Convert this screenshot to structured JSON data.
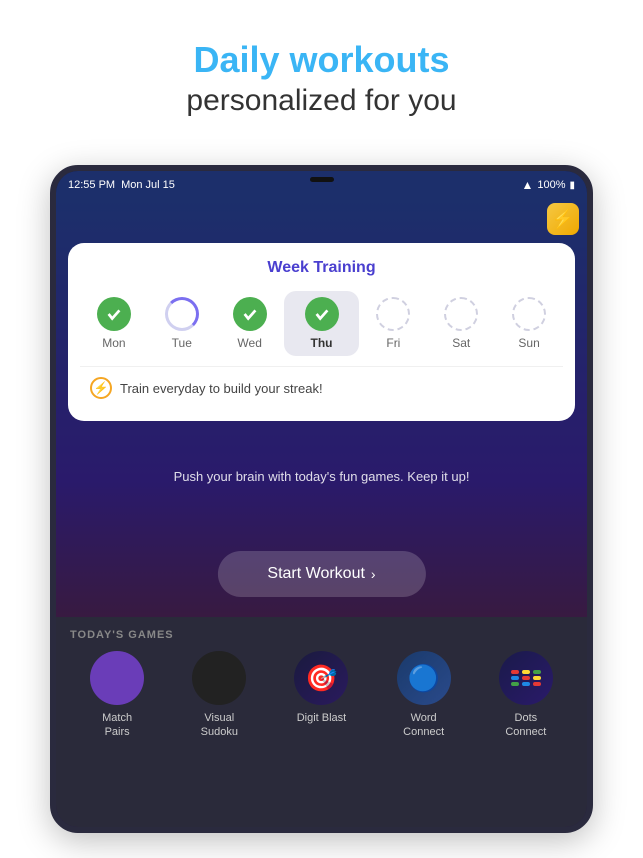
{
  "hero": {
    "title": "Daily workouts",
    "subtitle": "personalized for you"
  },
  "status_bar": {
    "time": "12:55 PM",
    "date": "Mon Jul 15",
    "wifi": "WiFi",
    "battery": "100%"
  },
  "week_training": {
    "title": "Week Training",
    "days": [
      {
        "label": "Mon",
        "state": "completed"
      },
      {
        "label": "Tue",
        "state": "partial"
      },
      {
        "label": "Wed",
        "state": "completed"
      },
      {
        "label": "Thu",
        "state": "active",
        "selected": true
      },
      {
        "label": "Fri",
        "state": "empty"
      },
      {
        "label": "Sat",
        "state": "empty"
      },
      {
        "label": "Sun",
        "state": "empty"
      }
    ],
    "streak_text": "Train everyday to build your streak!"
  },
  "push_text": "Push your brain with today's fun games. Keep it up!",
  "start_workout": {
    "label": "Start Workout",
    "chevron": "›"
  },
  "todays_games": {
    "section_label": "TODAY'S GAMES",
    "games": [
      {
        "name": "Match\nPairs",
        "icon_type": "match-pairs"
      },
      {
        "name": "Visual\nSudoku",
        "icon_type": "sudoku"
      },
      {
        "name": "Digit Blast",
        "icon_type": "digit-blast"
      },
      {
        "name": "Word\nConnect",
        "icon_type": "word-connect"
      },
      {
        "name": "Dots\nConnect",
        "icon_type": "dots-connect"
      }
    ]
  },
  "colors": {
    "accent_blue": "#3ab5f5",
    "text_dark": "#333333",
    "card_title": "#4a3fcf",
    "green": "#4CAF50"
  }
}
